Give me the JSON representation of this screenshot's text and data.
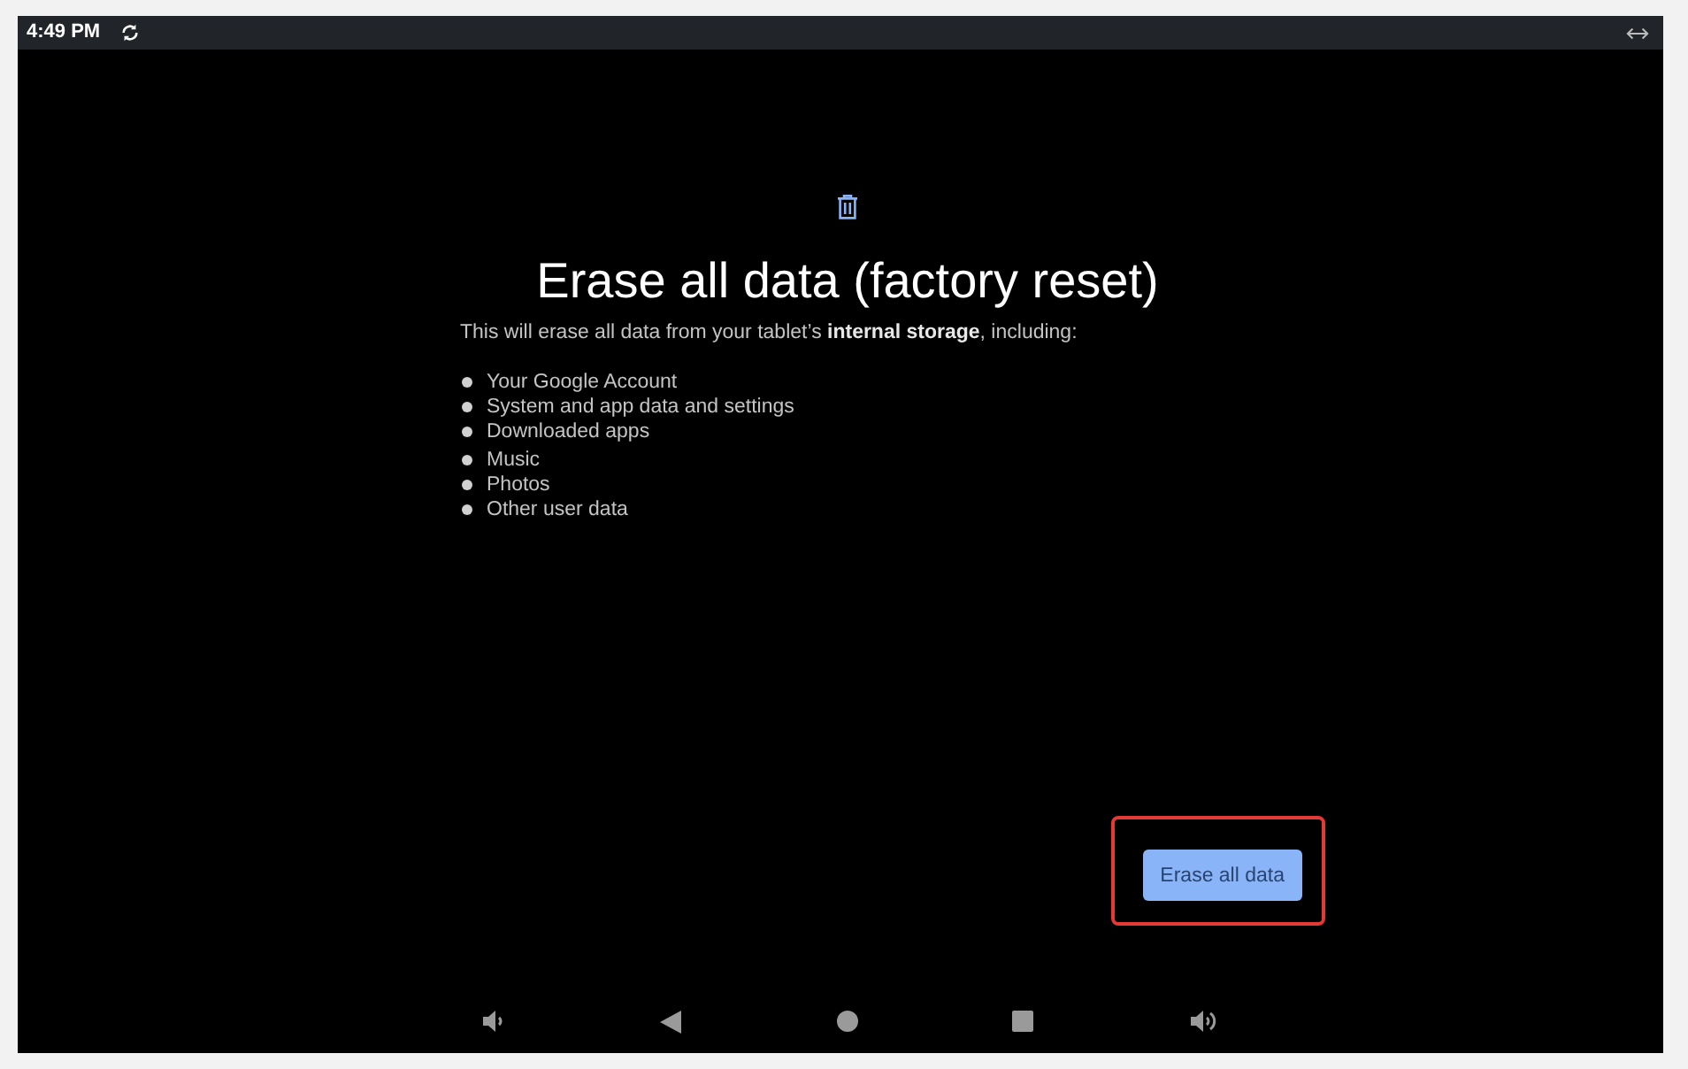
{
  "status_bar": {
    "time": "4:49 PM"
  },
  "page": {
    "title": "Erase all data (factory reset)",
    "description": "This will erase all data from your tablet’s **internal storage**, including:",
    "item_groups": [
      [
        "Your Google Account",
        "System and app data and settings",
        "Downloaded apps"
      ],
      [
        "Music",
        "Photos",
        "Other user data"
      ]
    ]
  },
  "button": {
    "label": "Erase all data",
    "highlighted": true
  },
  "nav_bar": {
    "buttons": [
      {
        "kind": "volume_down"
      },
      {
        "kind": "back"
      },
      {
        "kind": "home"
      },
      {
        "kind": "recents"
      },
      {
        "kind": "volume_up"
      }
    ]
  }
}
